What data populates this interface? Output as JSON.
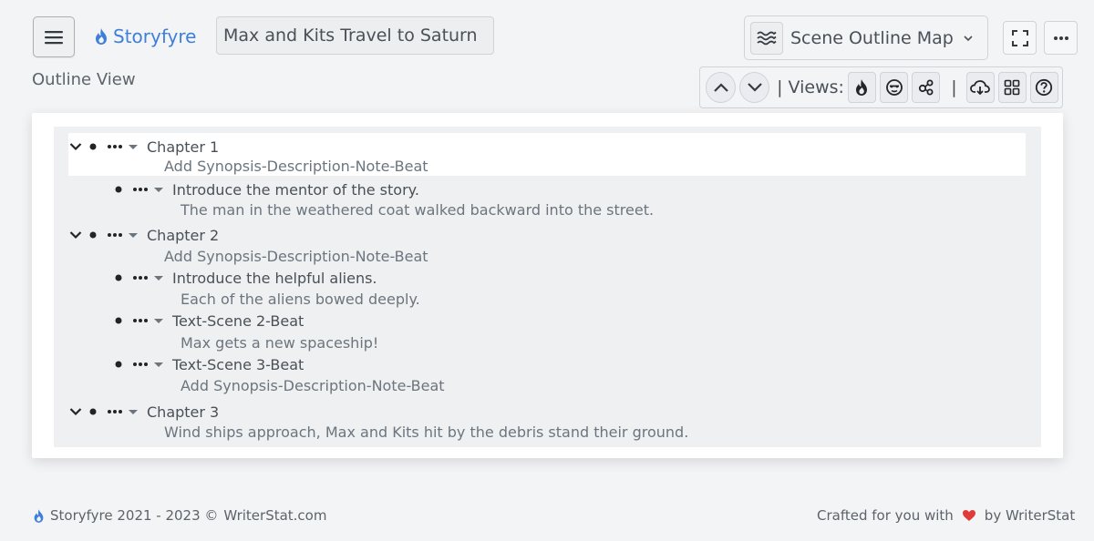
{
  "header": {
    "brand": "Storyfyre",
    "story_title": "Max and Kits Travel to Saturn",
    "view_select": "Scene Outline Map"
  },
  "page": {
    "section_label": "Outline View"
  },
  "toolbar": {
    "views_label": "| Views:",
    "separator": "|"
  },
  "outline": {
    "chapters": [
      {
        "title": "Chapter 1",
        "note": "Add Synopsis-Description-Note-Beat",
        "scenes": [
          {
            "title": "Introduce the mentor of the story.",
            "note": "The man in the weathered coat walked backward into the street."
          }
        ]
      },
      {
        "title": "Chapter 2",
        "note": "Add Synopsis-Description-Note-Beat",
        "scenes": [
          {
            "title": "Introduce the helpful aliens.",
            "note": "Each of the aliens bowed deeply."
          },
          {
            "title": "Text-Scene 2-Beat",
            "note": "Max gets a new spaceship!"
          },
          {
            "title": "Text-Scene 3-Beat",
            "note": "Add Synopsis-Description-Note-Beat"
          }
        ]
      },
      {
        "title": "Chapter 3",
        "note": "Wind ships approach, Max and Kits hit by the debris stand their ground.",
        "scenes": []
      }
    ]
  },
  "footer": {
    "copyright": "Storyfyre 2021 - 2023 ©",
    "site": "WriterStat.com",
    "crafted_prefix": "Crafted for you with",
    "crafted_suffix": "by WriterStat"
  },
  "colors": {
    "brand_blue": "#3f7fd9",
    "heart_red": "#e03b3b",
    "background": "#f3f4f6"
  }
}
